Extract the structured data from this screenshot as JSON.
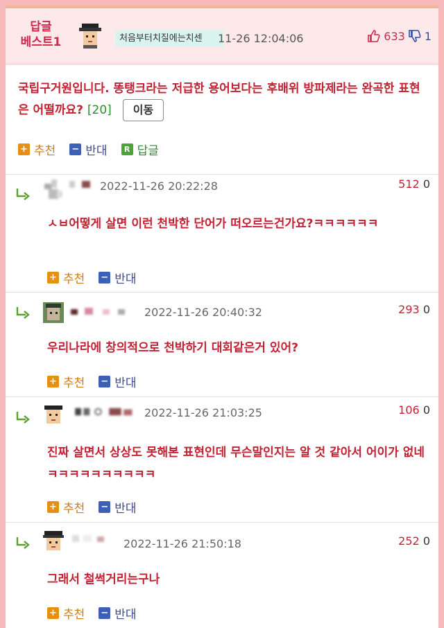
{
  "best": {
    "label": "답글\n베스트1",
    "nickname": "처음부터치질에는치센",
    "date": "11-26 12:04:06",
    "up_count": "633",
    "down_count": "1"
  },
  "post": {
    "text": "국립구거원입니다. 똥탱크라는 저급한 용어보다는 후배위 방파제라는 완곡한 표현은 어떨까요?",
    "comment_count": "[20]",
    "move_label": "이동"
  },
  "actions": {
    "recommend": "추천",
    "oppose": "반대",
    "reply": "답글",
    "reply_badge": "R"
  },
  "comments": [
    {
      "date": "2022-11-26 20:22:28",
      "up": "512",
      "down": "0",
      "text": "ㅅㅂ어떻게 살면 이런 천박한 단어가 떠오르는건가요?ㅋㅋㅋㅋㅋㅋ"
    },
    {
      "date": "2022-11-26 20:40:32",
      "up": "293",
      "down": "0",
      "text": "우리나라에 창의적으로 천박하기 대회같은거 있어?"
    },
    {
      "date": "2022-11-26 21:03:25",
      "up": "106",
      "down": "0",
      "text": "진짜 살면서 상상도 못해본 표현인데 무슨말인지는 알 것 같아서 어이가 없네 ㅋㅋㅋㅋㅋㅋㅋㅋㅋㅋ"
    },
    {
      "date": "2022-11-26 21:50:18",
      "up": "252",
      "down": "0",
      "text": "그래서 철썩거리는구나"
    }
  ],
  "colors": {
    "accent_red": "#c42032",
    "recommend_orange": "#e69012",
    "oppose_blue": "#3d5fb8",
    "reply_green": "#4ca437"
  }
}
